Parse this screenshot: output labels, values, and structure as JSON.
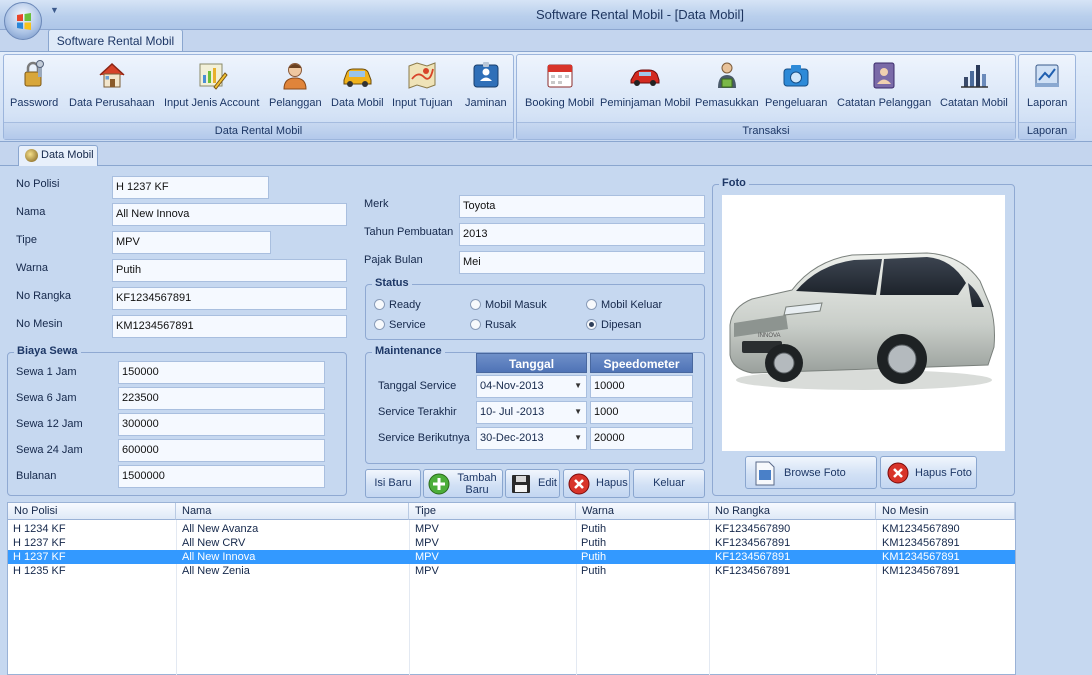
{
  "window": {
    "title": "Software Rental Mobil - [Data Mobil]"
  },
  "ribbon": {
    "tab_label": "Software Rental Mobil",
    "groups": [
      {
        "label": "Data Rental Mobil"
      },
      {
        "label": "Transaksi"
      },
      {
        "label": "Laporan"
      }
    ],
    "buttons": [
      {
        "label": "Password",
        "icon": "lock-key-icon"
      },
      {
        "label": "Data Perusahaan",
        "icon": "house-icon"
      },
      {
        "label": "Input Jenis Account",
        "icon": "chart-pencil-icon"
      },
      {
        "label": "Pelanggan",
        "icon": "user-icon"
      },
      {
        "label": "Data Mobil",
        "icon": "car-icon"
      },
      {
        "label": "Input Tujuan",
        "icon": "map-icon"
      },
      {
        "label": "Jaminan",
        "icon": "id-card-icon"
      },
      {
        "label": "Booking Mobil",
        "icon": "calendar-icon"
      },
      {
        "label": "Peminjaman Mobil",
        "icon": "red-car-icon"
      },
      {
        "label": "Pemasukkan",
        "icon": "money-person-icon"
      },
      {
        "label": "Pengeluaran",
        "icon": "camera-icon"
      },
      {
        "label": "Catatan Pelanggan",
        "icon": "contacts-book-icon"
      },
      {
        "label": "Catatan Mobil",
        "icon": "bar-chart-icon"
      },
      {
        "label": "Laporan",
        "icon": "report-icon"
      }
    ]
  },
  "doc_tab": {
    "label": "Data Mobil"
  },
  "form": {
    "no_polisi": {
      "label": "No Polisi",
      "value": "H 1237 KF"
    },
    "nama": {
      "label": "Nama",
      "value": "All New Innova"
    },
    "tipe": {
      "label": "Tipe",
      "value": "MPV"
    },
    "warna": {
      "label": "Warna",
      "value": "Putih"
    },
    "no_rangka": {
      "label": "No Rangka",
      "value": "KF1234567891"
    },
    "no_mesin": {
      "label": "No Mesin",
      "value": "KM1234567891"
    },
    "merk": {
      "label": "Merk",
      "value": "Toyota"
    },
    "tahun": {
      "label": "Tahun Pembuatan",
      "value": "2013"
    },
    "pajak": {
      "label": "Pajak Bulan",
      "value": "Mei"
    }
  },
  "biaya_sewa": {
    "title": "Biaya Sewa",
    "rows": [
      {
        "label": "Sewa 1 Jam",
        "value": "150000"
      },
      {
        "label": "Sewa 6 Jam",
        "value": "223500"
      },
      {
        "label": "Sewa 12 Jam",
        "value": "300000"
      },
      {
        "label": "Sewa 24 Jam",
        "value": "600000"
      },
      {
        "label": "Bulanan",
        "value": "1500000"
      }
    ]
  },
  "status": {
    "title": "Status",
    "options": [
      {
        "label": "Ready",
        "checked": false
      },
      {
        "label": "Mobil Masuk",
        "checked": false
      },
      {
        "label": "Mobil Keluar",
        "checked": false
      },
      {
        "label": "Service",
        "checked": false
      },
      {
        "label": "Rusak",
        "checked": false
      },
      {
        "label": "Dipesan",
        "checked": true
      }
    ]
  },
  "maintenance": {
    "title": "Maintenance",
    "col_tanggal": "Tanggal",
    "col_speedometer": "Speedometer",
    "rows": [
      {
        "label": "Tanggal Service",
        "tanggal": "04-Nov-2013",
        "speedometer": "10000"
      },
      {
        "label": "Service Terakhir",
        "tanggal": "10- Jul -2013",
        "speedometer": "1000"
      },
      {
        "label": "Service Berikutnya",
        "tanggal": "30-Dec-2013",
        "speedometer": "20000"
      }
    ]
  },
  "actions": {
    "isi_baru": "Isi Baru",
    "tambah_baru_1": "Tambah",
    "tambah_baru_2": "Baru",
    "edit": "Edit",
    "hapus": "Hapus",
    "keluar": "Keluar"
  },
  "foto": {
    "title": "Foto",
    "browse": "Browse Foto",
    "hapus": "Hapus Foto",
    "car_badge": "INNOVA"
  },
  "grid": {
    "columns": [
      "No Polisi",
      "Nama",
      "Tipe",
      "Warna",
      "No Rangka",
      "No Mesin"
    ],
    "rows": [
      [
        "H 1234 KF",
        "All New Avanza",
        "MPV",
        "Putih",
        "KF1234567890",
        "KM1234567890"
      ],
      [
        "H 1237 KF",
        "All New CRV",
        "MPV",
        "Putih",
        "KF1234567891",
        "KM1234567891"
      ],
      [
        "H 1237 KF",
        "All New Innova",
        "MPV",
        "Putih",
        "KF1234567891",
        "KM1234567891"
      ],
      [
        "H 1235 KF",
        "All New Zenia",
        "MPV",
        "Putih",
        "KF1234567891",
        "KM1234567891"
      ]
    ],
    "selected_row": 2
  }
}
